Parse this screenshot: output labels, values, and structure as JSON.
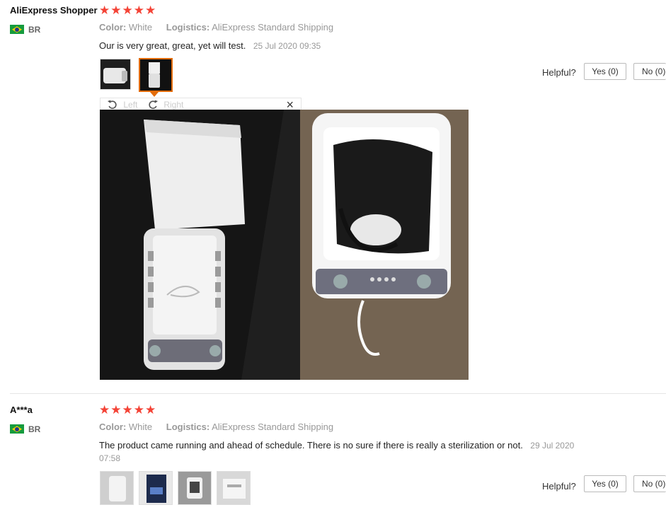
{
  "reviews": [
    {
      "user": "AliExpress Shopper",
      "country": "BR",
      "stars": "★★★★★",
      "color_key": "Color:",
      "color_val": "White",
      "logistics_key": "Logistics:",
      "logistics_val": "AliExpress Standard Shipping",
      "text": "Our is very great, great, yet will test.",
      "date": "25 Jul 2020 09:35",
      "helpful": "Helpful?",
      "yes": "Yes (0)",
      "no": "No (0)"
    },
    {
      "user": "A***a",
      "country": "BR",
      "stars": "★★★★★",
      "color_key": "Color:",
      "color_val": "White",
      "logistics_key": "Logistics:",
      "logistics_val": "AliExpress Standard Shipping",
      "text": "The product came running and ahead of schedule. There is no sure if there is really a sterilization or not.",
      "date_part1": "29 Jul 2020",
      "date_part2": "07:58",
      "helpful": "Helpful?",
      "yes": "Yes (0)",
      "no": "No (0)"
    }
  ],
  "viewer": {
    "left_label": "Left",
    "right_label": "Right",
    "close_glyph": "×"
  },
  "icons": {
    "rotate_left": "rotate-left-icon",
    "rotate_right": "rotate-right-icon",
    "close": "close-icon",
    "flag": "brazil-flag-icon"
  },
  "colors": {
    "star": "#f44336",
    "selected_border": "#e36c0a"
  }
}
